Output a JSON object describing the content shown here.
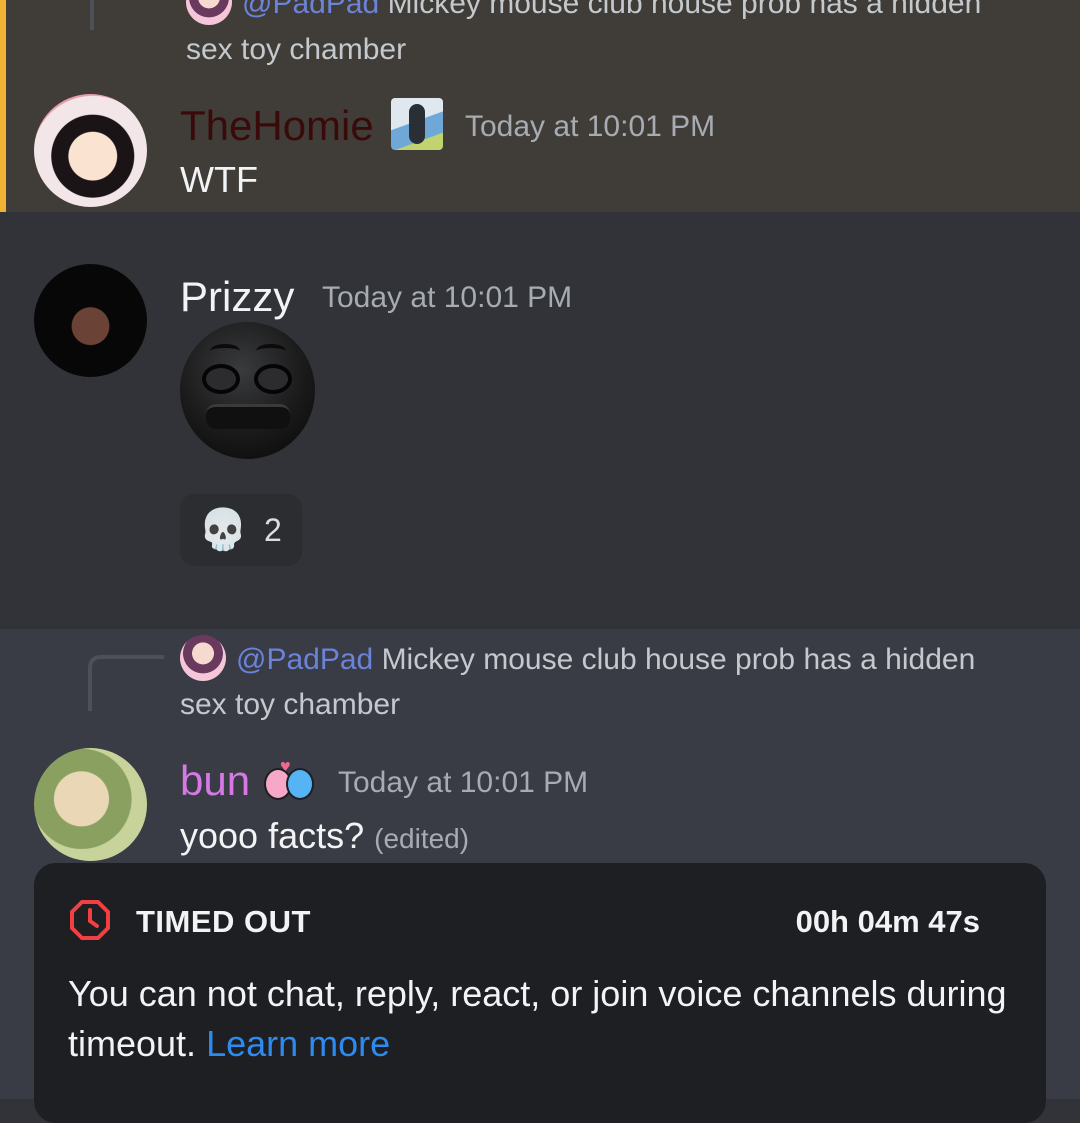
{
  "messages": [
    {
      "reply": {
        "mention": "@PadPad",
        "text_line1": "Mickey mouse club house prob has a hidden",
        "text_line2": "sex toy chamber"
      },
      "author": "TheHomie",
      "author_color": "#3a0a0a",
      "timestamp": "Today at 10:01 PM",
      "content": "WTF",
      "highlighted_mention": true
    },
    {
      "author": "Prizzy",
      "author_color": "#f2f3f5",
      "timestamp": "Today at 10:01 PM",
      "content_type": "sticker",
      "reaction": {
        "emoji": "💀",
        "count": "2"
      }
    },
    {
      "reply": {
        "mention": "@PadPad",
        "text_line1": "Mickey mouse club house prob has a hidden",
        "text_line2": "sex toy chamber"
      },
      "author": "bun",
      "author_color": "#d678e6",
      "timestamp": "Today at 10:01 PM",
      "content": "yooo facts?",
      "edited_label": "(edited)"
    }
  ],
  "timeout_banner": {
    "title": "TIMED OUT",
    "remaining": "00h 04m 47s",
    "description": "You can not chat, reply, react, or join voice channels during timeout.",
    "link_label": "Learn more",
    "accent_color": "#f23f43"
  }
}
